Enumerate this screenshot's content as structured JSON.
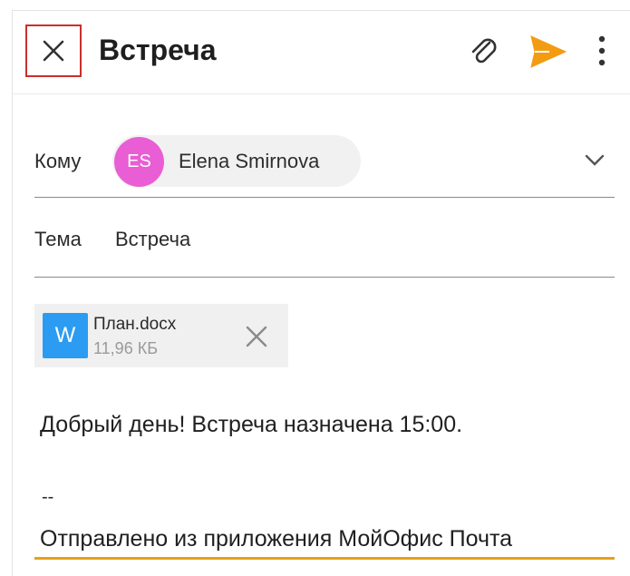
{
  "header": {
    "title": "Встреча",
    "close_icon": "close-icon",
    "attach_icon": "paperclip-icon",
    "send_icon": "send-icon",
    "more_icon": "more-vertical-icon",
    "send_color": "#f39c12",
    "close_highlight_color": "#c9302c"
  },
  "to": {
    "label": "Кому",
    "recipient": {
      "initials": "ES",
      "name": "Elena Smirnova",
      "avatar_color": "#e95ed4"
    },
    "expand_icon": "chevron-down-icon"
  },
  "subject": {
    "label": "Тема",
    "value": "Встреча"
  },
  "attachment": {
    "icon_letter": "W",
    "name": "План.docx",
    "size": "11,96 КБ",
    "remove_icon": "close-icon",
    "icon_color": "#2b9cf2"
  },
  "message": {
    "body": "Добрый день! Встреча назначена 15:00.",
    "signature_separator": "--",
    "signature": "Отправлено из приложения МойОфис Почта",
    "focus_color": "#e6a01b"
  }
}
